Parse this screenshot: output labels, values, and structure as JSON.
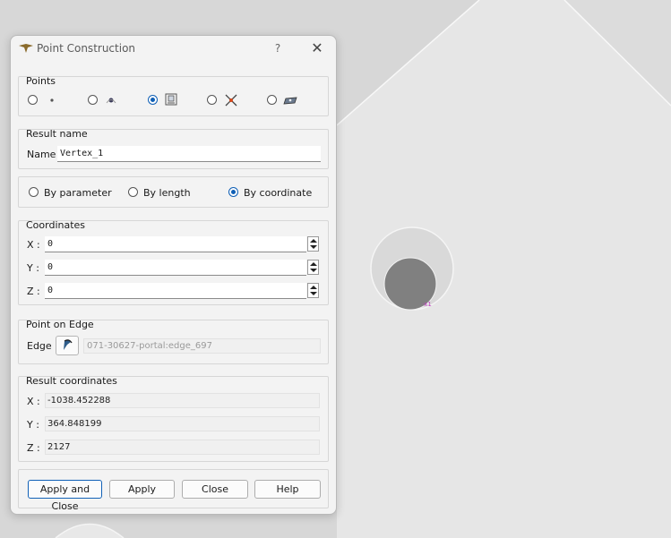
{
  "dialog": {
    "title": "Point Construction",
    "help": "?",
    "close": "✕",
    "points_group": {
      "title": "Points",
      "options": [
        {
          "icon": "point-icon",
          "checked": false
        },
        {
          "icon": "point-on-curve-icon",
          "checked": false
        },
        {
          "icon": "point-by-coordinates-icon",
          "checked": true
        },
        {
          "icon": "point-intersection-icon",
          "checked": false
        },
        {
          "icon": "point-on-surface-icon",
          "checked": false
        }
      ]
    },
    "result_name": {
      "title": "Result name",
      "label": "Name",
      "value": "Vertex_1"
    },
    "mode": {
      "options": [
        {
          "label": "By parameter",
          "checked": false
        },
        {
          "label": "By length",
          "checked": false
        },
        {
          "label": "By coordinate",
          "checked": true
        }
      ]
    },
    "coordinates": {
      "title": "Coordinates",
      "x_label": "X :",
      "x_value": "0",
      "y_label": "Y :",
      "y_value": "0",
      "z_label": "Z :",
      "z_value": "0"
    },
    "point_on_edge": {
      "title": "Point on Edge",
      "label": "Edge",
      "value": "071-30627-portal:edge_697"
    },
    "result_coordinates": {
      "title": "Result coordinates",
      "x_label": "X :",
      "x_value": "-1038.452288",
      "y_label": "Y :",
      "y_value": "364.848199",
      "z_label": "Z :",
      "z_value": "2127"
    },
    "buttons": {
      "apply_close": "Apply and Close",
      "apply": "Apply",
      "close": "Close",
      "help": "Help"
    }
  },
  "colors": {
    "accent": "#0f5fb5",
    "viewport_bg": "#dcdcdc",
    "shape_light": "#e6e6e6",
    "sphere": "#808080"
  }
}
